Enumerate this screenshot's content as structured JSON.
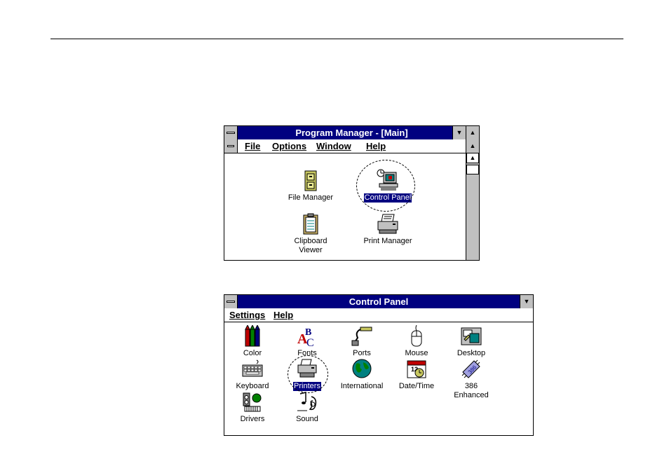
{
  "program_manager": {
    "title": "Program Manager - [Main]",
    "menu": [
      "File",
      "Options",
      "Window",
      "Help"
    ],
    "icons": [
      {
        "label": "File Manager"
      },
      {
        "label": "Control Panel",
        "selected": true
      },
      {
        "label": "Clipboard Viewer"
      },
      {
        "label": "Print Manager"
      }
    ]
  },
  "control_panel": {
    "title": "Control Panel",
    "menu": [
      "Settings",
      "Help"
    ],
    "icons": [
      {
        "label": "Color"
      },
      {
        "label": "Fonts"
      },
      {
        "label": "Ports"
      },
      {
        "label": "Mouse"
      },
      {
        "label": "Desktop"
      },
      {
        "label": "Keyboard"
      },
      {
        "label": "Printers",
        "selected": true
      },
      {
        "label": "International"
      },
      {
        "label": "Date/Time"
      },
      {
        "label": "386 Enhanced"
      },
      {
        "label": "Drivers"
      },
      {
        "label": "Sound"
      }
    ]
  }
}
